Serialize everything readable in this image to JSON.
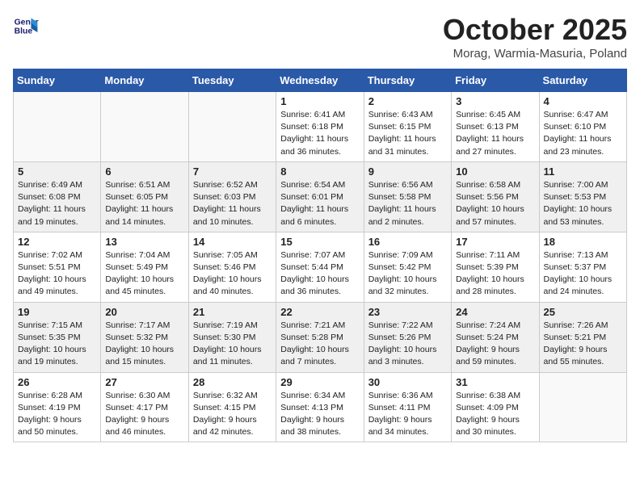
{
  "header": {
    "logo_line1": "General",
    "logo_line2": "Blue",
    "month": "October 2025",
    "location": "Morag, Warmia-Masuria, Poland"
  },
  "weekdays": [
    "Sunday",
    "Monday",
    "Tuesday",
    "Wednesday",
    "Thursday",
    "Friday",
    "Saturday"
  ],
  "weeks": [
    [
      {
        "day": "",
        "info": ""
      },
      {
        "day": "",
        "info": ""
      },
      {
        "day": "",
        "info": ""
      },
      {
        "day": "1",
        "info": "Sunrise: 6:41 AM\nSunset: 6:18 PM\nDaylight: 11 hours\nand 36 minutes."
      },
      {
        "day": "2",
        "info": "Sunrise: 6:43 AM\nSunset: 6:15 PM\nDaylight: 11 hours\nand 31 minutes."
      },
      {
        "day": "3",
        "info": "Sunrise: 6:45 AM\nSunset: 6:13 PM\nDaylight: 11 hours\nand 27 minutes."
      },
      {
        "day": "4",
        "info": "Sunrise: 6:47 AM\nSunset: 6:10 PM\nDaylight: 11 hours\nand 23 minutes."
      }
    ],
    [
      {
        "day": "5",
        "info": "Sunrise: 6:49 AM\nSunset: 6:08 PM\nDaylight: 11 hours\nand 19 minutes."
      },
      {
        "day": "6",
        "info": "Sunrise: 6:51 AM\nSunset: 6:05 PM\nDaylight: 11 hours\nand 14 minutes."
      },
      {
        "day": "7",
        "info": "Sunrise: 6:52 AM\nSunset: 6:03 PM\nDaylight: 11 hours\nand 10 minutes."
      },
      {
        "day": "8",
        "info": "Sunrise: 6:54 AM\nSunset: 6:01 PM\nDaylight: 11 hours\nand 6 minutes."
      },
      {
        "day": "9",
        "info": "Sunrise: 6:56 AM\nSunset: 5:58 PM\nDaylight: 11 hours\nand 2 minutes."
      },
      {
        "day": "10",
        "info": "Sunrise: 6:58 AM\nSunset: 5:56 PM\nDaylight: 10 hours\nand 57 minutes."
      },
      {
        "day": "11",
        "info": "Sunrise: 7:00 AM\nSunset: 5:53 PM\nDaylight: 10 hours\nand 53 minutes."
      }
    ],
    [
      {
        "day": "12",
        "info": "Sunrise: 7:02 AM\nSunset: 5:51 PM\nDaylight: 10 hours\nand 49 minutes."
      },
      {
        "day": "13",
        "info": "Sunrise: 7:04 AM\nSunset: 5:49 PM\nDaylight: 10 hours\nand 45 minutes."
      },
      {
        "day": "14",
        "info": "Sunrise: 7:05 AM\nSunset: 5:46 PM\nDaylight: 10 hours\nand 40 minutes."
      },
      {
        "day": "15",
        "info": "Sunrise: 7:07 AM\nSunset: 5:44 PM\nDaylight: 10 hours\nand 36 minutes."
      },
      {
        "day": "16",
        "info": "Sunrise: 7:09 AM\nSunset: 5:42 PM\nDaylight: 10 hours\nand 32 minutes."
      },
      {
        "day": "17",
        "info": "Sunrise: 7:11 AM\nSunset: 5:39 PM\nDaylight: 10 hours\nand 28 minutes."
      },
      {
        "day": "18",
        "info": "Sunrise: 7:13 AM\nSunset: 5:37 PM\nDaylight: 10 hours\nand 24 minutes."
      }
    ],
    [
      {
        "day": "19",
        "info": "Sunrise: 7:15 AM\nSunset: 5:35 PM\nDaylight: 10 hours\nand 19 minutes."
      },
      {
        "day": "20",
        "info": "Sunrise: 7:17 AM\nSunset: 5:32 PM\nDaylight: 10 hours\nand 15 minutes."
      },
      {
        "day": "21",
        "info": "Sunrise: 7:19 AM\nSunset: 5:30 PM\nDaylight: 10 hours\nand 11 minutes."
      },
      {
        "day": "22",
        "info": "Sunrise: 7:21 AM\nSunset: 5:28 PM\nDaylight: 10 hours\nand 7 minutes."
      },
      {
        "day": "23",
        "info": "Sunrise: 7:22 AM\nSunset: 5:26 PM\nDaylight: 10 hours\nand 3 minutes."
      },
      {
        "day": "24",
        "info": "Sunrise: 7:24 AM\nSunset: 5:24 PM\nDaylight: 9 hours\nand 59 minutes."
      },
      {
        "day": "25",
        "info": "Sunrise: 7:26 AM\nSunset: 5:21 PM\nDaylight: 9 hours\nand 55 minutes."
      }
    ],
    [
      {
        "day": "26",
        "info": "Sunrise: 6:28 AM\nSunset: 4:19 PM\nDaylight: 9 hours\nand 50 minutes."
      },
      {
        "day": "27",
        "info": "Sunrise: 6:30 AM\nSunset: 4:17 PM\nDaylight: 9 hours\nand 46 minutes."
      },
      {
        "day": "28",
        "info": "Sunrise: 6:32 AM\nSunset: 4:15 PM\nDaylight: 9 hours\nand 42 minutes."
      },
      {
        "day": "29",
        "info": "Sunrise: 6:34 AM\nSunset: 4:13 PM\nDaylight: 9 hours\nand 38 minutes."
      },
      {
        "day": "30",
        "info": "Sunrise: 6:36 AM\nSunset: 4:11 PM\nDaylight: 9 hours\nand 34 minutes."
      },
      {
        "day": "31",
        "info": "Sunrise: 6:38 AM\nSunset: 4:09 PM\nDaylight: 9 hours\nand 30 minutes."
      },
      {
        "day": "",
        "info": ""
      }
    ]
  ]
}
